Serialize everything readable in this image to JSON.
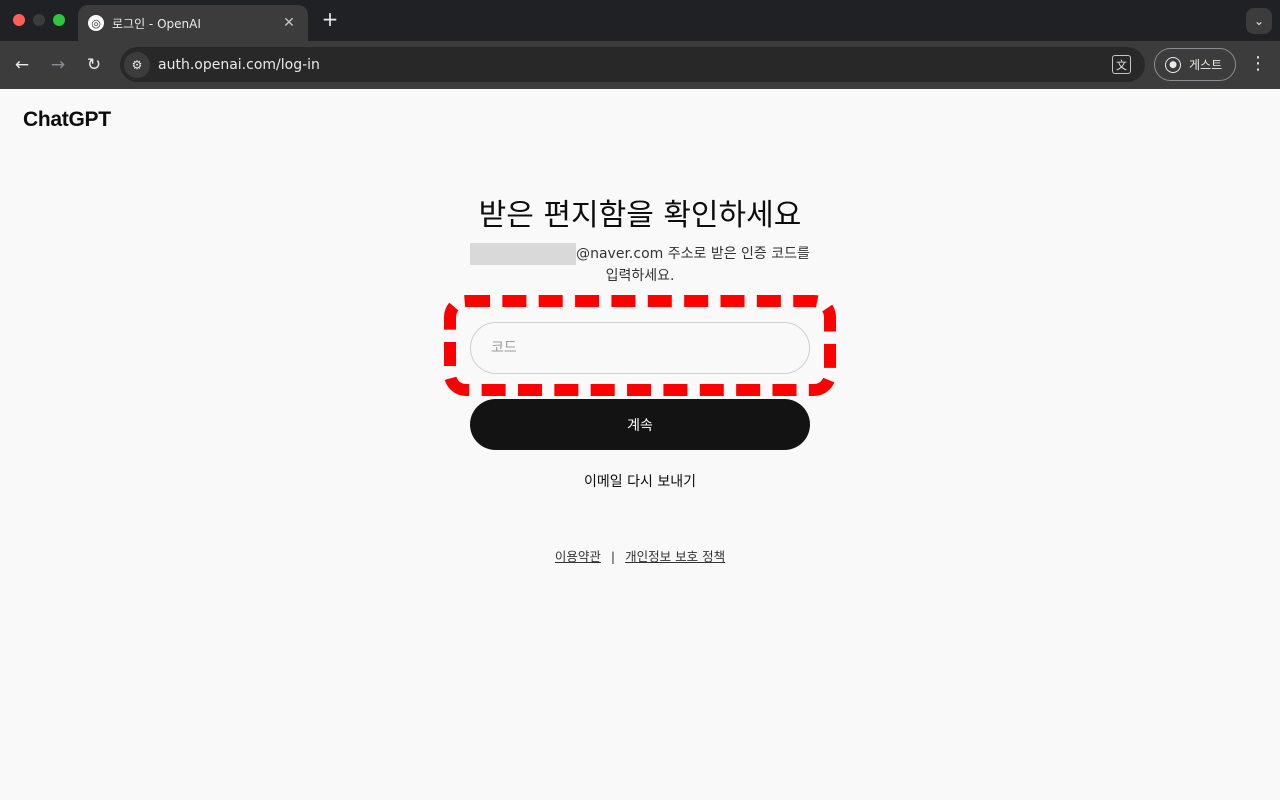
{
  "browser": {
    "tab": {
      "title": "로그인 - OpenAI",
      "close": "✕",
      "favicon_glyph": "◎"
    },
    "new_tab_label": "+",
    "dropdown_glyph": "⌄",
    "nav": {
      "back": "←",
      "forward": "→",
      "reload": "↻"
    },
    "site_info_glyph": "⚙",
    "url": "auth.openai.com/log-in",
    "translate_glyph": "文",
    "profile": {
      "glyph": "●",
      "label": "게스트"
    },
    "menu_glyph": "⋮"
  },
  "page": {
    "logo": "ChatGPT",
    "heading": "받은 편지함을 확인하세요",
    "subtitle_email_domain": "@naver.com",
    "subtitle_rest": " 주소로 받은 인증 코드를 입력하세요.",
    "code_input": {
      "value": "",
      "placeholder": "코드"
    },
    "continue_label": "계속",
    "resend_label": "이메일 다시 보내기",
    "footer": {
      "terms": "이용약관",
      "separator": "|",
      "privacy": "개인정보 보호 정책"
    }
  },
  "colors": {
    "highlight": "#ff0000",
    "button": "#131313",
    "page_bg": "#f9f9f9"
  }
}
